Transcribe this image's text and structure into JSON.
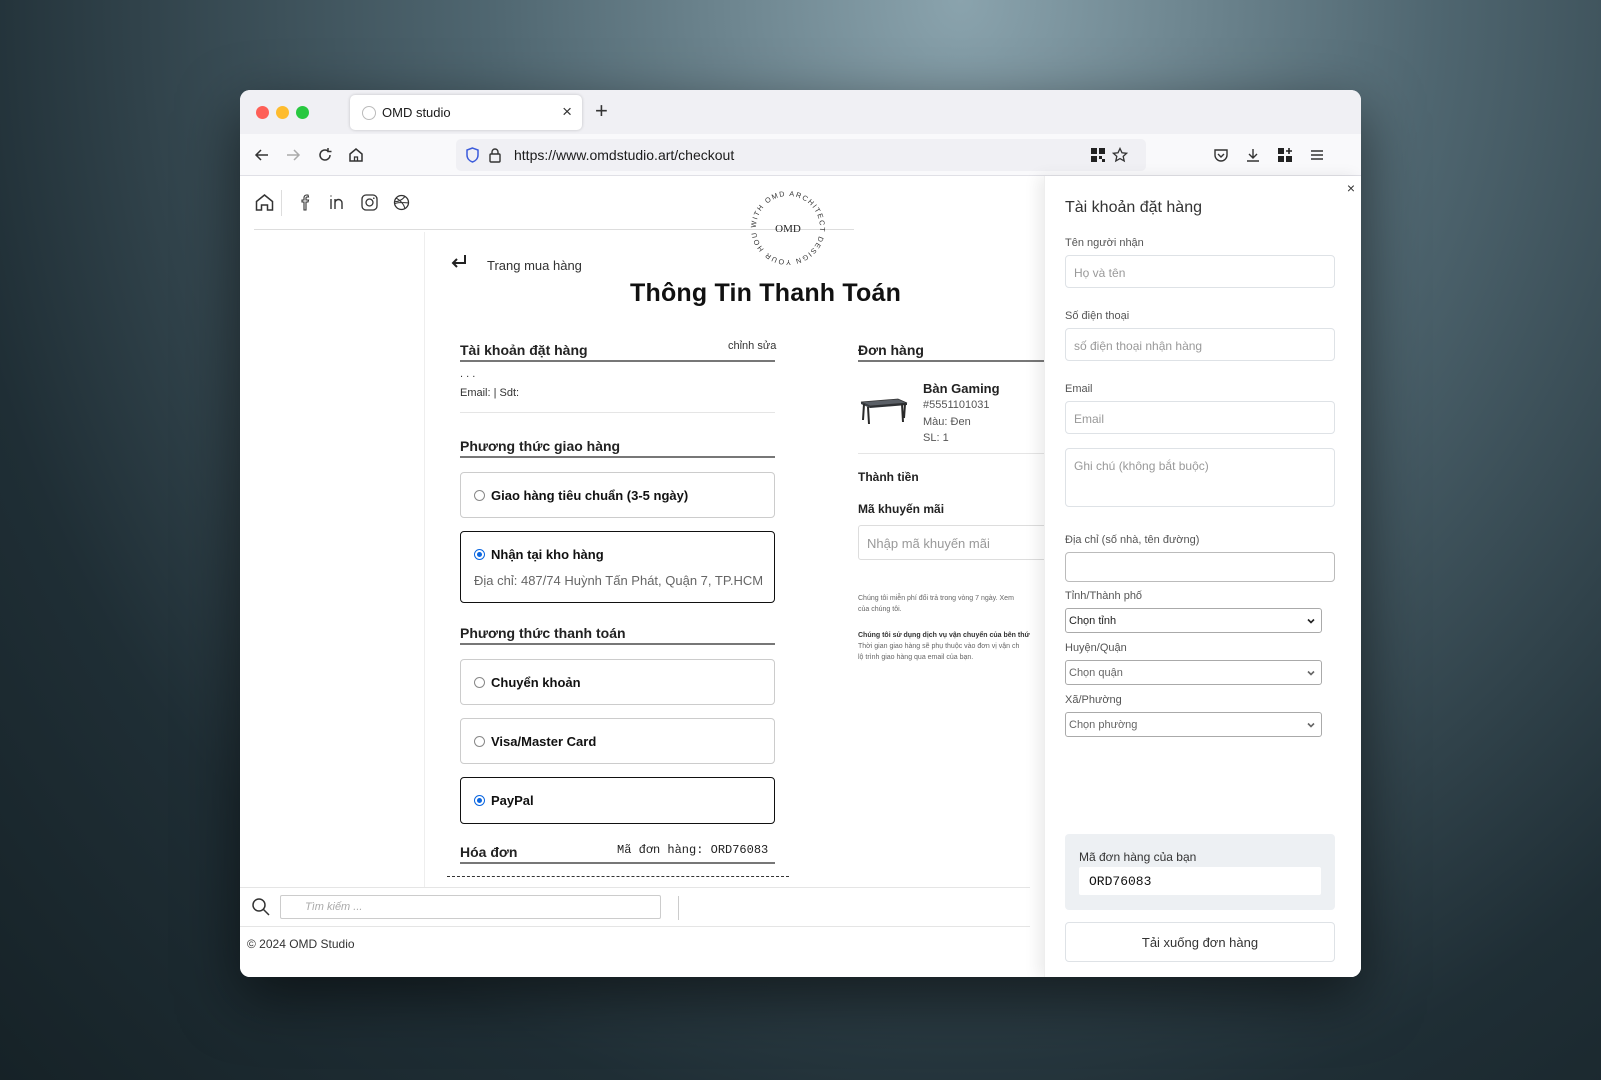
{
  "browser": {
    "tab_title": "OMD studio",
    "url": "https://www.omdstudio.art/checkout"
  },
  "logo": {
    "center_text": "OMD",
    "ring_text": "WITH OMD ARCHITECT DESIGN YOUR HOUSE"
  },
  "nav": {
    "back_label": "Trang mua hàng"
  },
  "page_title": "Thông Tin Thanh Toán",
  "account": {
    "title": "Tài khoản đặt hàng",
    "edit_label": "chỉnh sửa",
    "dots": ". . .",
    "contact": "Email:  | Sdt:"
  },
  "shipping": {
    "title": "Phương thức giao hàng",
    "options": [
      {
        "label": "Giao hàng tiêu chuẩn (3-5 ngày)",
        "selected": false
      },
      {
        "label": "Nhận tại kho hàng",
        "selected": true,
        "address": "Địa chỉ: 487/74 Huỳnh Tấn Phát, Quận 7, TP.HCM"
      }
    ]
  },
  "payment": {
    "title": "Phương thức thanh toán",
    "options": [
      {
        "label": "Chuyển khoản",
        "selected": false
      },
      {
        "label": "Visa/Master Card",
        "selected": false
      },
      {
        "label": "PayPal",
        "selected": true
      }
    ]
  },
  "invoice": {
    "title": "Hóa đơn",
    "order_code": "Mã đơn hàng: ORD76083"
  },
  "order": {
    "title": "Đơn hàng",
    "product": {
      "name": "Bàn Gaming",
      "sku": "#5551101031",
      "color": "Màu: Đen",
      "qty": "SL: 1"
    },
    "subtotal_label": "Thành tiền",
    "promo_title": "Mã khuyến mãi",
    "promo_placeholder": "Nhập mã khuyến mãi",
    "note1": "Chúng tôi miễn phí đổi trả trong vòng 7 ngày. Xem",
    "note1b": "của chúng tôi.",
    "note2": "Chúng tôi sử dụng dịch vụ vận chuyển của bên thứ",
    "note3": "Thời gian giao hàng sẽ phụ thuộc vào đơn vị vận ch",
    "note4": "lộ trình giao hàng qua email của bạn."
  },
  "search": {
    "placeholder": "Tìm kiếm ..."
  },
  "footer": "© 2024 OMD Studio",
  "drawer": {
    "close": "×",
    "title": "Tài khoản đặt hàng",
    "name_label": "Tên người nhận",
    "name_placeholder": "Họ và tên",
    "phone_label": "Số điện thoại",
    "phone_placeholder": "số điện thoại nhận hàng",
    "email_label": "Email",
    "email_placeholder": "Email",
    "note_placeholder": "Ghi chú (không bắt buộc)",
    "address_label": "Địa chỉ (số nhà, tên đường)",
    "address_value": "",
    "province_label": "Tỉnh/Thành phố",
    "province_value": "Chọn tỉnh",
    "district_label": "Huyện/Quận",
    "district_value": "Chọn quận",
    "ward_label": "Xã/Phường",
    "ward_value": "Chọn phường",
    "order_code_label": "Mã đơn hàng của bạn",
    "order_code_value": "ORD76083",
    "download_label": "Tải xuống đơn hàng"
  },
  "colors": {
    "radio_accent": "#0a66e0",
    "close_red": "#fe5f57",
    "minimize_yellow": "#febc2e",
    "zoom_green": "#28c840"
  }
}
